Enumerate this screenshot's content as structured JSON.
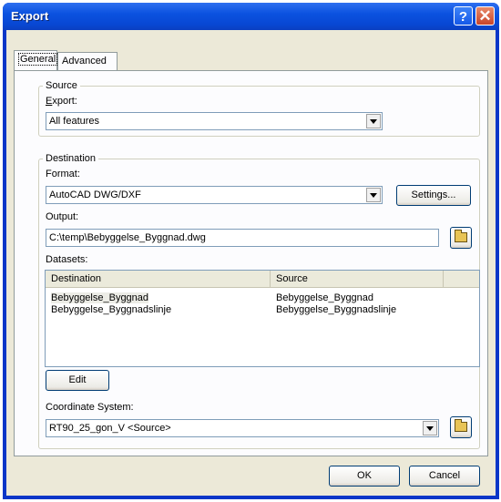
{
  "window": {
    "title": "Export",
    "help_glyph": "?",
    "close_glyph": "✕"
  },
  "tabs": [
    {
      "label": "General"
    },
    {
      "label": "Advanced"
    }
  ],
  "source": {
    "legend": "Source",
    "export_label": "Export:",
    "export_value": "All features"
  },
  "destination": {
    "legend": "Destination",
    "format_label": "Format:",
    "format_value": "AutoCAD DWG/DXF",
    "settings_button": "Settings...",
    "output_label": "Output:",
    "output_value": "C:\\temp\\Bebyggelse_Byggnad.dwg",
    "datasets_label": "Datasets:",
    "columns": [
      "Destination",
      "Source"
    ],
    "rows": [
      {
        "destination": "Bebyggelse_Byggnad",
        "source": "Bebyggelse_Byggnad"
      },
      {
        "destination": "Bebyggelse_Byggnadslinje",
        "source": "Bebyggelse_Byggnadslinje"
      }
    ],
    "edit_button": "Edit",
    "coord_label": "Coordinate System:",
    "coord_value": "RT90_25_gon_V <Source>"
  },
  "footer": {
    "ok_button": "OK",
    "cancel_button": "Cancel"
  },
  "icons": {
    "folder": "folder-open-icon",
    "dropdown": "chevron-down-icon"
  }
}
